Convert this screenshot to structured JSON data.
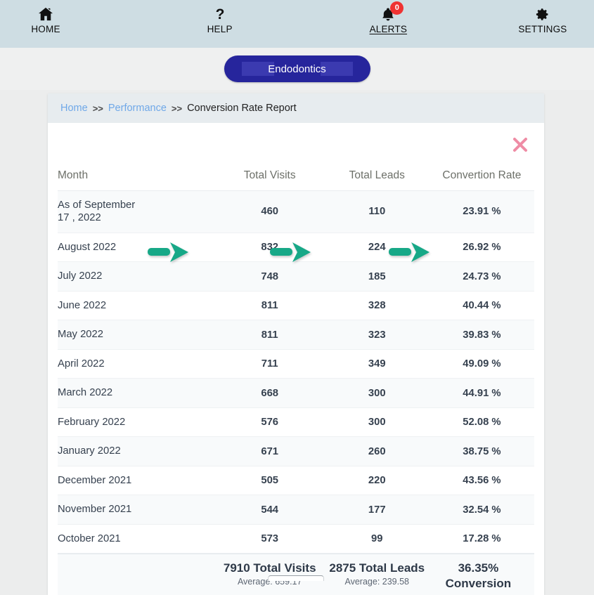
{
  "topnav": {
    "items": [
      {
        "label": "HOME",
        "icon": "home-icon",
        "badge": null,
        "underline": false
      },
      {
        "label": "HELP",
        "icon": "help-icon",
        "badge": null,
        "underline": false
      },
      {
        "label": "ALERTS",
        "icon": "bell-icon",
        "badge": "0",
        "underline": true
      },
      {
        "label": "SETTINGS",
        "icon": "gear-icon",
        "badge": null,
        "underline": false
      }
    ]
  },
  "specialty_button": {
    "label": "Endodontics"
  },
  "breadcrumb": {
    "home": "Home",
    "sep1": ">>",
    "performance": "Performance",
    "sep2": ">>",
    "current": "Conversion Rate Report"
  },
  "close_button": {
    "label": "×"
  },
  "table": {
    "headers": {
      "month": "Month",
      "visits": "Total Visits",
      "leads": "Total Leads",
      "rate": "Convertion Rate"
    },
    "rows": [
      {
        "month": "As of September 17 , 2022",
        "visits": "460",
        "leads": "110",
        "rate": "23.91 %"
      },
      {
        "month": "August 2022",
        "visits": "832",
        "leads": "224",
        "rate": "26.92 %"
      },
      {
        "month": "July 2022",
        "visits": "748",
        "leads": "185",
        "rate": "24.73 %"
      },
      {
        "month": "June 2022",
        "visits": "811",
        "leads": "328",
        "rate": "40.44 %"
      },
      {
        "month": "May 2022",
        "visits": "811",
        "leads": "323",
        "rate": "39.83 %"
      },
      {
        "month": "April 2022",
        "visits": "711",
        "leads": "349",
        "rate": "49.09 %"
      },
      {
        "month": "March 2022",
        "visits": "668",
        "leads": "300",
        "rate": "44.91 %"
      },
      {
        "month": "February 2022",
        "visits": "576",
        "leads": "300",
        "rate": "52.08 %"
      },
      {
        "month": "January 2022",
        "visits": "671",
        "leads": "260",
        "rate": "38.75 %"
      },
      {
        "month": "December 2021",
        "visits": "505",
        "leads": "220",
        "rate": "43.56 %"
      },
      {
        "month": "November 2021",
        "visits": "544",
        "leads": "177",
        "rate": "32.54 %"
      },
      {
        "month": "October 2021",
        "visits": "573",
        "leads": "99",
        "rate": "17.28 %"
      }
    ],
    "totals": {
      "visits_main": "7910 Total Visits",
      "visits_sub": "Average: 659.17",
      "leads_main": "2875 Total Leads",
      "leads_sub": "Average: 239.58",
      "rate_main": "36.35%",
      "rate_sub": "Conversion"
    }
  },
  "annotations": {
    "arrows": [
      {
        "name": "arrow-to-total-visits",
        "target_row": "August 2022",
        "points_to": "832"
      },
      {
        "name": "arrow-to-total-leads",
        "target_row": "August 2022",
        "points_to": "224"
      },
      {
        "name": "arrow-to-conversion",
        "target_row": "August 2022",
        "points_to": "26.92 %"
      }
    ]
  },
  "colors": {
    "topbar_bg": "#cedde3",
    "page_bg": "#eceded",
    "pill_blue": "#26259c",
    "link_blue": "#6fa8e8",
    "arrow_green": "#17a887",
    "close_pink": "#ef8ca5",
    "badge_red": "#ef3232"
  }
}
